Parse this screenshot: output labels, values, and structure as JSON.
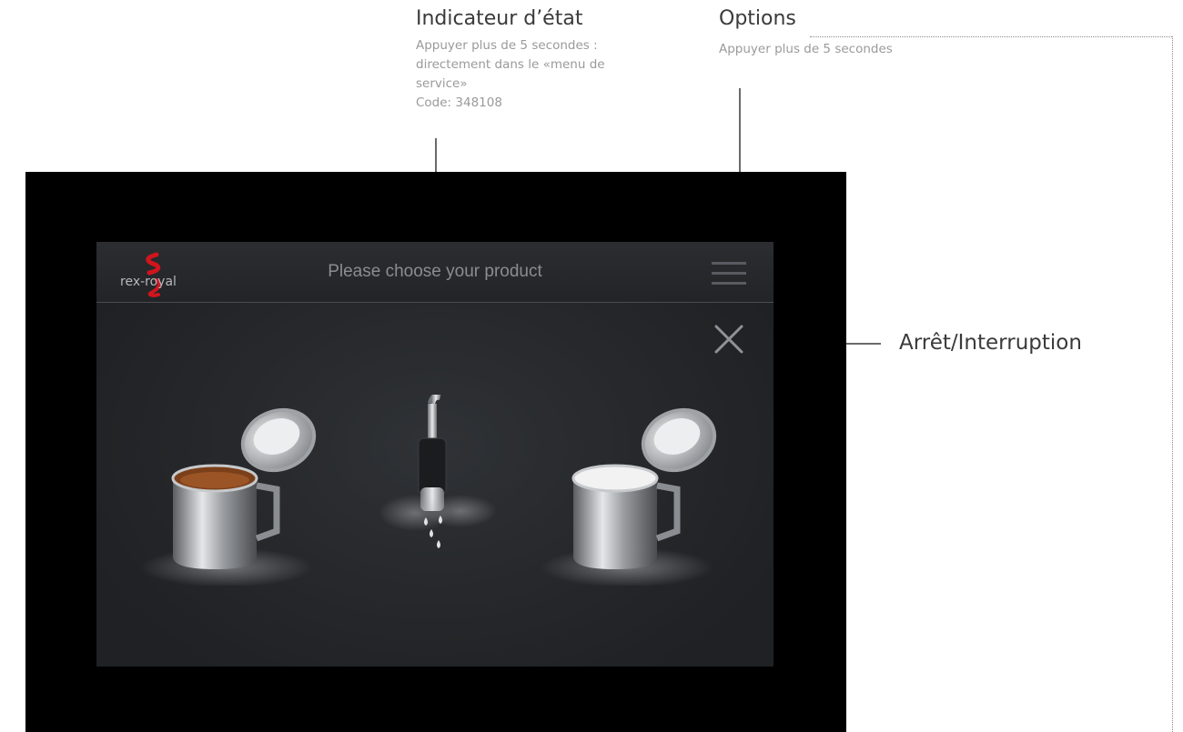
{
  "annotations": {
    "status": {
      "title": "Indicateur d’état",
      "lines": [
        "Appuyer plus de 5 secondes :",
        "directement dans le «menu de",
        "service»",
        "Code: 348108"
      ]
    },
    "options": {
      "title": "Options",
      "line": "Appuyer plus de 5 secondes"
    },
    "stop": {
      "title": "Arrêt/Interruption"
    }
  },
  "screen": {
    "logo_text": "rex-royal",
    "prompt": "Please choose your product",
    "icons": {
      "menu": "hamburger-menu-icon",
      "close": "close-icon"
    },
    "products": [
      {
        "name": "coffee-pot",
        "contents_color": "#8a4a1e"
      },
      {
        "name": "hot-water-spout",
        "contents_color": "#dfe3e6"
      },
      {
        "name": "milk-pot",
        "contents_color": "#f2f2f2"
      }
    ]
  },
  "colors": {
    "device": "#000000",
    "screen_bg": "#26282b",
    "brand_red": "#d0151d",
    "annotation_text": "#3a3a3a",
    "annotation_sub": "#9a9a9a"
  }
}
